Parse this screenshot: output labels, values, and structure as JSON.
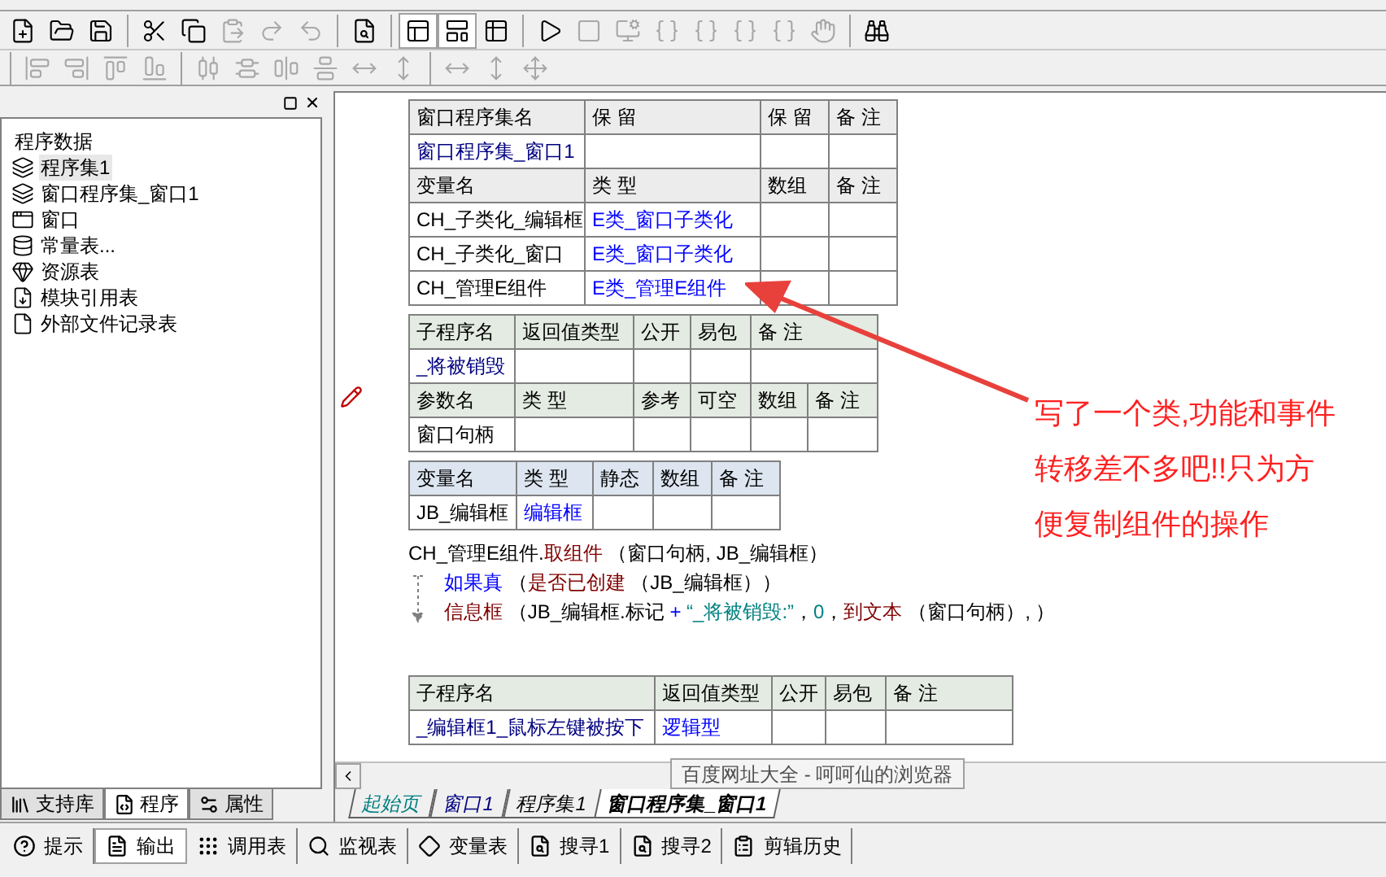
{
  "toolbar_1": [
    {
      "kind": "new",
      "disabled": false,
      "pressed": false
    },
    {
      "kind": "open",
      "disabled": false,
      "pressed": false
    },
    {
      "kind": "save",
      "disabled": false,
      "pressed": false
    },
    {
      "kind": "sep"
    },
    {
      "kind": "cut",
      "disabled": false,
      "pressed": false
    },
    {
      "kind": "copy",
      "disabled": false,
      "pressed": false
    },
    {
      "kind": "paste",
      "disabled": true,
      "pressed": false
    },
    {
      "kind": "redo",
      "disabled": true,
      "pressed": false
    },
    {
      "kind": "undo",
      "disabled": true,
      "pressed": false
    },
    {
      "kind": "sep"
    },
    {
      "kind": "find",
      "disabled": false,
      "pressed": false
    },
    {
      "kind": "sep"
    },
    {
      "kind": "layout_a",
      "disabled": false,
      "pressed": true
    },
    {
      "kind": "layout_b",
      "disabled": false,
      "pressed": true
    },
    {
      "kind": "layout_c",
      "disabled": false,
      "pressed": false
    },
    {
      "kind": "sep"
    },
    {
      "kind": "run",
      "disabled": false,
      "pressed": false
    },
    {
      "kind": "stop",
      "disabled": true,
      "pressed": false
    },
    {
      "kind": "monitor",
      "disabled": true,
      "pressed": false
    },
    {
      "kind": "step",
      "disabled": true,
      "pressed": false
    },
    {
      "kind": "step",
      "disabled": true,
      "pressed": false
    },
    {
      "kind": "step",
      "disabled": true,
      "pressed": false
    },
    {
      "kind": "step",
      "disabled": true,
      "pressed": false
    },
    {
      "kind": "hand",
      "disabled": true,
      "pressed": false
    },
    {
      "kind": "sep"
    },
    {
      "kind": "help",
      "disabled": false,
      "pressed": false
    }
  ],
  "toolbar_2": [
    {
      "kind": "sep"
    },
    {
      "kind": "align_left",
      "disabled": true
    },
    {
      "kind": "align_right",
      "disabled": true
    },
    {
      "kind": "align_top",
      "disabled": true
    },
    {
      "kind": "align_bottom",
      "disabled": true
    },
    {
      "kind": "sep"
    },
    {
      "kind": "center_h",
      "disabled": true
    },
    {
      "kind": "center_v",
      "disabled": true
    },
    {
      "kind": "justify_h",
      "disabled": true
    },
    {
      "kind": "justify_v",
      "disabled": true
    },
    {
      "kind": "space_h",
      "disabled": true
    },
    {
      "kind": "space_v",
      "disabled": true
    },
    {
      "kind": "sep"
    },
    {
      "kind": "width",
      "disabled": true
    },
    {
      "kind": "height",
      "disabled": true
    },
    {
      "kind": "size",
      "disabled": true
    }
  ],
  "left_panel": {
    "tree": {
      "label": "程序数据",
      "children": [
        {
          "kind": "assembly",
          "label": "程序集1",
          "selected": true
        },
        {
          "kind": "assembly",
          "label": "窗口程序集_窗口1",
          "selected": false
        },
        {
          "kind": "window",
          "label": "窗口",
          "selected": false
        },
        {
          "kind": "constants",
          "label": "常量表...",
          "selected": false
        },
        {
          "kind": "resources",
          "label": "资源表",
          "selected": false
        },
        {
          "kind": "module",
          "label": "模块引用表",
          "selected": false
        },
        {
          "kind": "file",
          "label": "外部文件记录表",
          "selected": false
        }
      ]
    },
    "tabs": [
      {
        "kind": "library",
        "label": "支持库",
        "selected": false
      },
      {
        "kind": "program",
        "label": "程序",
        "selected": true
      },
      {
        "kind": "property",
        "label": "属性",
        "selected": false
      }
    ]
  },
  "editor": {
    "sections": [
      {
        "kind": "table",
        "rows": [
          {
            "kind": "header",
            "cells": [
              {
                "text": "窗口程序集名"
              },
              {
                "text": "保 留"
              },
              {
                "text": "保 留"
              },
              {
                "text": "备 注"
              }
            ]
          },
          {
            "kind": "data",
            "cells": [
              {
                "text": "窗口程序集_窗口1",
                "color": "#000080"
              },
              {
                "text": ""
              },
              {
                "text": ""
              },
              {
                "text": ""
              }
            ]
          },
          {
            "kind": "header",
            "cells": [
              {
                "text": "变量名"
              },
              {
                "text": "类 型"
              },
              {
                "text": "数组"
              },
              {
                "text": "备 注"
              }
            ]
          },
          {
            "kind": "data",
            "cells": [
              {
                "text": "CH_子类化_编辑框"
              },
              {
                "text": "E类_窗口子类化",
                "color": "#0000ff"
              },
              {
                "text": ""
              },
              {
                "text": ""
              }
            ]
          },
          {
            "kind": "data",
            "cells": [
              {
                "text": "CH_子类化_窗口"
              },
              {
                "text": "E类_窗口子类化",
                "color": "#0000ff"
              },
              {
                "text": ""
              },
              {
                "text": ""
              }
            ]
          },
          {
            "kind": "data",
            "cells": [
              {
                "text": "CH_管理E组件"
              },
              {
                "text": "E类_管理E组件",
                "color": "#0000ff"
              },
              {
                "text": ""
              },
              {
                "text": ""
              }
            ]
          }
        ]
      },
      {
        "kind": "table",
        "breakpoint": true,
        "rows": [
          {
            "kind": "header",
            "cells": [
              {
                "text": "子程序名"
              },
              {
                "text": "返回值类型"
              },
              {
                "text": "公开"
              },
              {
                "text": "易包"
              },
              {
                "text": "备 注"
              }
            ]
          },
          {
            "kind": "data",
            "cells": [
              {
                "text": "_将被销毁",
                "color": "#000080"
              },
              {
                "text": ""
              },
              {
                "text": ""
              },
              {
                "text": ""
              },
              {
                "text": ""
              }
            ]
          },
          {
            "kind": "param_header",
            "cells": [
              {
                "text": "参数名"
              },
              {
                "text": "类 型"
              },
              {
                "text": "参考"
              },
              {
                "text": "可空"
              },
              {
                "text": "数组"
              },
              {
                "text": "备 注"
              }
            ]
          },
          {
            "kind": "param",
            "cells": [
              {
                "text": "窗口句柄"
              },
              {
                "text": ""
              },
              {
                "text": ""
              },
              {
                "text": ""
              },
              {
                "text": ""
              },
              {
                "text": ""
              }
            ]
          }
        ]
      },
      {
        "kind": "table",
        "rows": [
          {
            "kind": "header",
            "cells": [
              {
                "text": "变量名"
              },
              {
                "text": "类 型"
              },
              {
                "text": "静态"
              },
              {
                "text": "数组"
              },
              {
                "text": "备 注"
              }
            ]
          },
          {
            "kind": "data",
            "cells": [
              {
                "text": "JB_编辑框"
              },
              {
                "text": "编辑框",
                "color": "#0000ff"
              },
              {
                "text": ""
              },
              {
                "text": ""
              },
              {
                "text": ""
              }
            ]
          }
        ]
      },
      {
        "kind": "code",
        "lines": [
          {
            "tokens": [
              {
                "kind": "plain",
                "text": "CH_管理E组件."
              },
              {
                "kind": "command",
                "text": "取组件"
              },
              {
                "kind": "plain",
                "text": " （窗口句柄, JB_编辑框）"
              }
            ]
          }
        ],
        "block": [
          {
            "tokens": [
              {
                "kind": "keyword",
                "text": "如果真"
              },
              {
                "kind": "plain",
                "text": " （"
              },
              {
                "kind": "command",
                "text": "是否已创建"
              },
              {
                "kind": "plain",
                "text": " （JB_编辑框））"
              }
            ]
          },
          {
            "tokens": [
              {
                "kind": "command",
                "text": "信息框"
              },
              {
                "kind": "plain",
                "text": " （JB_编辑框.标记 "
              },
              {
                "kind": "operator",
                "text": "+"
              },
              {
                "kind": "string",
                "text": " “_将被销毁:”"
              },
              {
                "kind": "plain",
                "text": "，"
              },
              {
                "kind": "string",
                "text": "0"
              },
              {
                "kind": "plain",
                "text": "，"
              },
              {
                "kind": "command",
                "text": "到文本"
              },
              {
                "kind": "plain",
                "text": " （窗口句柄）, ）"
              }
            ]
          }
        ]
      },
      {
        "kind": "table",
        "rows": [
          {
            "kind": "header",
            "cells": [
              {
                "text": "子程序名"
              },
              {
                "text": "返回值类型"
              },
              {
                "text": "公开"
              },
              {
                "text": "易包"
              },
              {
                "text": "备 注"
              }
            ]
          },
          {
            "kind": "data",
            "cells": [
              {
                "text": "_编辑框1_鼠标左键被按下",
                "color": "#000080"
              },
              {
                "text": "逻辑型",
                "color": "#0000ff"
              },
              {
                "text": ""
              },
              {
                "text": ""
              },
              {
                "text": ""
              }
            ]
          }
        ]
      }
    ],
    "annotation": [
      "写了一个类,功能和事件",
      "转移差不多吧!!只为方",
      "便复制组件的操作"
    ],
    "tooltip": "百度网址大全 - 呵呵仙的浏览器",
    "tabs": [
      {
        "label": "起始页",
        "color": "#008080",
        "selected": false
      },
      {
        "label": "窗口1",
        "color": "#000080",
        "selected": false
      },
      {
        "label": "程序集1",
        "color": "#000000",
        "selected": false
      },
      {
        "label": "窗口程序集_窗口1",
        "color": "#000000",
        "selected": true
      }
    ]
  },
  "bottom_tabs": [
    {
      "kind": "hint",
      "label": "提示",
      "selected": false
    },
    {
      "kind": "output",
      "label": "输出",
      "selected": true
    },
    {
      "kind": "calls",
      "label": "调用表",
      "selected": false
    },
    {
      "kind": "watch",
      "label": "监视表",
      "selected": false
    },
    {
      "kind": "vars",
      "label": "变量表",
      "selected": false
    },
    {
      "kind": "search",
      "label": "搜寻1",
      "selected": false
    },
    {
      "kind": "search",
      "label": "搜寻2",
      "selected": false
    },
    {
      "kind": "history",
      "label": "剪辑历史",
      "selected": false
    }
  ]
}
